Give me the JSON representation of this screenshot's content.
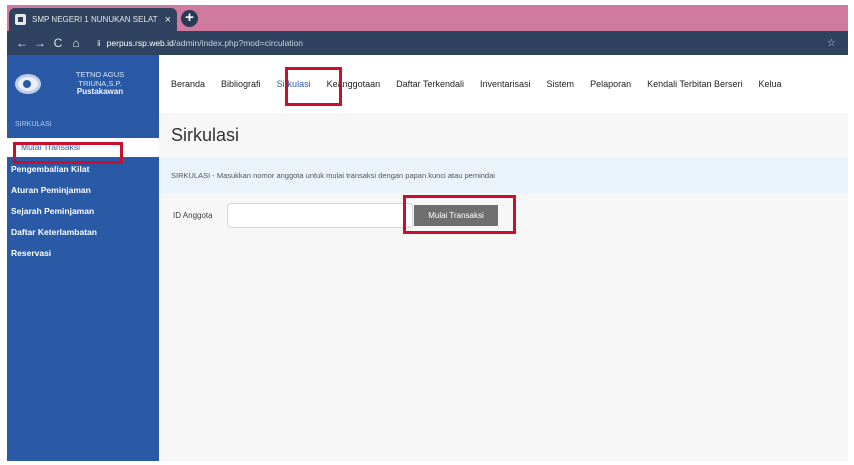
{
  "browser": {
    "tab_title": "SMP NEGERI 1 NUNUKAN SELAT",
    "tab_close": "×",
    "new_tab": "+",
    "url_domain": "perpus.rsp.web.id",
    "url_path": "/admin/index.php?mod=circulation",
    "nav": {
      "back": "←",
      "forward": "→",
      "reload": "C",
      "home": "⌂",
      "info": "ⅱ",
      "star": "☆"
    }
  },
  "sidebar": {
    "profile_name": "TETNO AGUS TRIUNA,S.P.",
    "profile_role": "Pustakawan",
    "menu_header": "SIRKULASI",
    "items": [
      {
        "label": "Mulai Transaksi",
        "active": true
      },
      {
        "label": "Pengembalian Kilat"
      },
      {
        "label": "Aturan Peminjaman"
      },
      {
        "label": "Sejarah Peminjaman"
      },
      {
        "label": "Daftar Keterlambatan"
      },
      {
        "label": "Reservasi"
      }
    ]
  },
  "topnav": [
    {
      "label": "Beranda"
    },
    {
      "label": "Bibliografi"
    },
    {
      "label": "Sirkulasi",
      "active": true
    },
    {
      "label": "Keanggotaan"
    },
    {
      "label": "Daftar Terkendali"
    },
    {
      "label": "Inventarisasi"
    },
    {
      "label": "Sistem"
    },
    {
      "label": "Pelaporan"
    },
    {
      "label": "Kendali Terbitan Berseri"
    },
    {
      "label": "Kelua"
    }
  ],
  "main": {
    "title": "Sirkulasi",
    "info": "SIRKULASI - Masukkan nomor anggota untuk mulai transaksi dengan papan kunci atau pemindai",
    "member_label": "ID Anggota",
    "member_value": "",
    "start_button": "Mulai Transaksi"
  },
  "colors": {
    "sidebar": "#2a5aa6",
    "highlight": "#c8102e",
    "tabstrip": "#d07aa0",
    "toolbar": "#2f4360"
  },
  "icons": [
    "tab-favicon-icon",
    "close-icon",
    "plus-icon",
    "back-icon",
    "forward-icon",
    "reload-icon",
    "home-icon",
    "site-info-icon",
    "star-icon",
    "avatar-logo-icon"
  ]
}
